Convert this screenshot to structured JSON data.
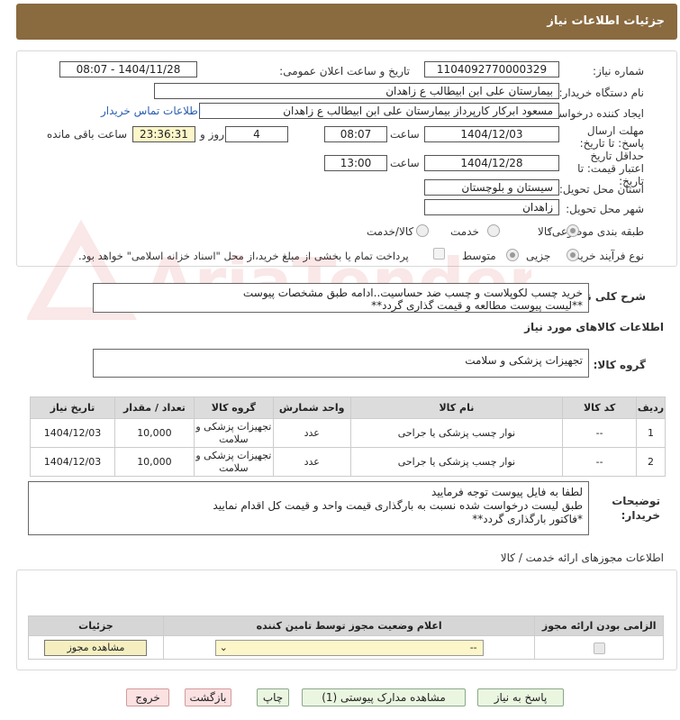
{
  "header": {
    "title": "جزئیات اطلاعات نیاز"
  },
  "form": {
    "need_number_label": "شماره نیاز:",
    "need_number": "1104092770000329",
    "announce_label": "تاریخ و ساعت اعلان عمومی:",
    "announce_value": "1404/11/28 - 08:07",
    "buyer_org_label": "نام دستگاه خریدار:",
    "buyer_org": "بیمارستان علی ابن ابیطالب  ع  زاهدان",
    "requester_label": "ایجاد کننده درخواست:",
    "requester": "مسعود ابرکار کارپرداز بیمارستان علی ابن ابیطالب  ع  زاهدان",
    "contact_link": "اطلاعات تماس خریدار",
    "reply_deadline_label": "مهلت ارسال پاسخ: تا تاریخ:",
    "reply_date": "1404/12/03",
    "time_label": "ساعت",
    "reply_time": "08:07",
    "days_value": "4",
    "days_label": "روز و",
    "remaining_time": "23:36:31",
    "remaining_label": "ساعت باقی مانده",
    "validity_label": "حداقل تاریخ اعتبار قیمت: تا تاریخ:",
    "validity_date": "1404/12/28",
    "validity_time": "13:00",
    "province_label": "استان محل تحویل:",
    "province": "سیستان و بلوچستان",
    "city_label": "شهر محل تحویل:",
    "city": "زاهدان",
    "category_label": "طبقه بندی موضوعی:",
    "category_options": [
      "کالا",
      "خدمت",
      "کالا/خدمت"
    ],
    "process_label": "نوع فرآیند خرید :",
    "process_options": [
      "جزیی",
      "متوسط"
    ],
    "payment_note": "پرداخت تمام یا بخشی از مبلغ خرید،از محل \"اسناد خزانه اسلامی\" خواهد بود."
  },
  "description": {
    "label": "شرح کلی نیاز:",
    "text": "خرید چسب لکوپلاست و چسب ضد حساسیت..ادامه طبق مشخصات پیوست\n**لیست پیوست مطالعه و قیمت گذاری گردد**"
  },
  "goods_info": {
    "title": "اطلاعات کالاهای مورد نیاز",
    "group_label": "گروه کالا:",
    "group_value": "تجهیزات پزشکی و سلامت"
  },
  "items_table": {
    "headers": [
      "ردیف",
      "کد کالا",
      "نام کالا",
      "واحد شمارش",
      "گروه کالا",
      "تعداد / مقدار",
      "تاریخ نیاز"
    ],
    "rows": [
      [
        "1",
        "--",
        "نوار چسب پزشکی یا جراحی",
        "عدد",
        "تجهیزات پزشکی و سلامت",
        "10,000",
        "1404/12/03"
      ],
      [
        "2",
        "--",
        "نوار چسب پزشکی یا جراحی",
        "عدد",
        "تجهیزات پزشکی و سلامت",
        "10,000",
        "1404/12/03"
      ]
    ]
  },
  "buyer_notes": {
    "label": "توضیحات خریدار:",
    "text": "لطفا به فایل پیوست توجه فرمایید\nطبق لیست درخواست شده نسبت به بارگذاری قیمت واحد و قیمت کل اقدام نمایید\n*فاکتور بارگذاری گردد**"
  },
  "permits": {
    "title": "اطلاعات مجوزهای ارائه خدمت / کالا",
    "headers": [
      "الزامی بودن ارائه مجوز",
      "اعلام وضعیت مجوز توسط تامین کننده",
      "جزئیات"
    ],
    "select_value": "--",
    "view_button": "مشاهده مجوز"
  },
  "buttons": {
    "reply": "پاسخ به نیاز",
    "attachments": "مشاهده مدارک پیوستی (1)",
    "print": "چاپ",
    "back": "بازگشت",
    "exit": "خروج"
  },
  "watermark": {
    "text": "AriaTender.neT"
  }
}
